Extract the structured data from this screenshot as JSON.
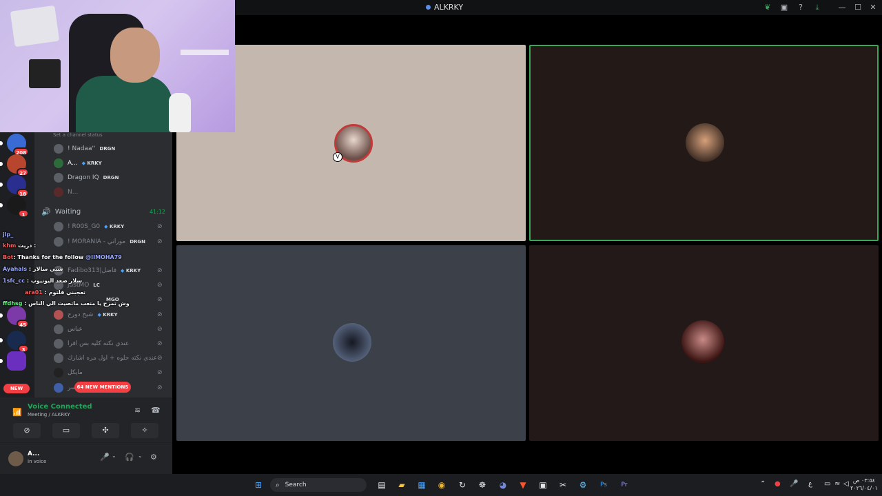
{
  "window": {
    "title": "ALKRKY"
  },
  "guilds": [
    {
      "badge": "208"
    },
    {
      "badge": "27"
    },
    {
      "badge": "18"
    },
    {
      "badge": "1"
    },
    {
      "badge": "45"
    },
    {
      "badge": "3"
    },
    {
      "badge": ""
    }
  ],
  "guild_new_label": "NEW",
  "channel": {
    "status_placeholder": "Set a channel status",
    "members_top": [
      {
        "name": "! Nadaa''",
        "tag": "DRGN"
      },
      {
        "name": "A...",
        "tag": "KRKY"
      },
      {
        "name": "Dragon IQ",
        "tag": "DRGN"
      },
      {
        "name": "N...",
        "tag": ""
      }
    ],
    "voice_channel": {
      "name": "Waiting",
      "time": "41:12"
    },
    "members_waiting": [
      {
        "name": "! R00S_G0",
        "tag": "KRKY"
      },
      {
        "name": "! MORANIA - موراني",
        "tag": "DRGN"
      },
      {
        "name": "Fadibo313|فاضل",
        "tag": "KRKY"
      },
      {
        "name": "justMO",
        "tag": "LC"
      },
      {
        "name": "",
        "tag": "MGO"
      },
      {
        "name": "شيخ دورج",
        "tag": "KRKY"
      },
      {
        "name": "عباس",
        "tag": ""
      },
      {
        "name": "عندي نكته كليه بس افرا",
        "tag": ""
      },
      {
        "name": "عندي نكته حلوه + اول مره اشارك",
        "tag": ""
      },
      {
        "name": "مايكل",
        "tag": ""
      },
      {
        "name": "سر",
        "tag": ""
      }
    ],
    "mentions_label": "64 NEW MENTIONS"
  },
  "chat_overlay": [
    {
      "user": "jlp_",
      "text": ""
    },
    {
      "user": "khm",
      "text": "دزيت :"
    },
    {
      "user": "Bot",
      "text": ": Thanks for the follow",
      "mention": "@IIMOHA79"
    },
    {
      "user": "Ayahals",
      "text": ": شبي سالار"
    },
    {
      "user": "1sfc_cc",
      "text": ": سلار صعد اليوتيوب"
    },
    {
      "user": "ara01",
      "text": ": تعجبني قلتوم"
    },
    {
      "user": "ffdhsg",
      "text": ": وش تمزح يا متعب ماتصيت الي الناس"
    }
  ],
  "voice_panel": {
    "title": "Voice Connected",
    "subtitle": "Meeting / ALKRKY"
  },
  "user_panel": {
    "name": "A...",
    "status": "In voice"
  },
  "taskbar": {
    "search_label": "Search",
    "clock_time": "٠٣:٥٤ ص",
    "clock_date": "٢٠٢٦/٠٤/٠١"
  },
  "colors": {
    "accent_green": "#23a559",
    "mention_red": "#f23f43",
    "tile_1": "#c4b8ae",
    "tile_2": "#231917",
    "tile_3": "#3b4049",
    "tile_4": "#221918"
  }
}
